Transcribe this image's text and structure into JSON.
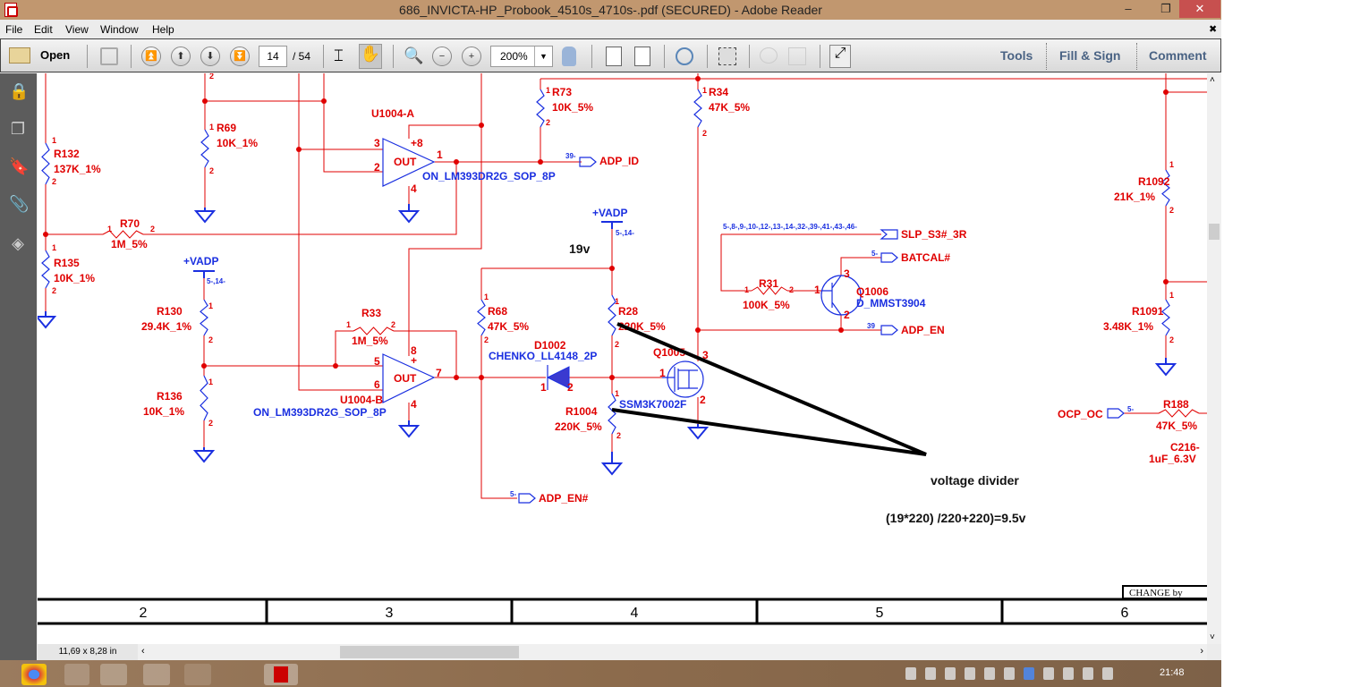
{
  "window": {
    "title": "686_INVICTA-HP_Probook_4510s_4710s-.pdf (SECURED) - Adobe Reader",
    "minimize": "‒",
    "restore": "❐",
    "close": "✕"
  },
  "menu": [
    "File",
    "Edit",
    "View",
    "Window",
    "Help"
  ],
  "menu_close": "✖",
  "toolbar": {
    "open": "Open",
    "page_current": "14",
    "page_total": "/ 54",
    "zoom": "200%",
    "tools": "Tools",
    "fill_sign": "Fill & Sign",
    "comment": "Comment"
  },
  "status": {
    "page_size": "11,69 x 8,28 in"
  },
  "clock": "21:48",
  "schematic": {
    "c": {
      "R132": [
        "R132",
        "137K_1%"
      ],
      "R135": [
        "R135",
        "10K_1%"
      ],
      "R70": [
        "R70",
        "1M_5%"
      ],
      "R69": [
        "R69",
        "10K_1%"
      ],
      "R130": [
        "R130",
        "29.4K_1%"
      ],
      "R136": [
        "R136",
        "10K_1%"
      ],
      "R33": [
        "R33",
        "1M_5%"
      ],
      "R73": [
        "R73",
        "10K_5%"
      ],
      "R34": [
        "R34",
        "47K_5%"
      ],
      "R68": [
        "R68",
        "47K_5%"
      ],
      "R28": [
        "R28",
        "220K_5%"
      ],
      "R1004": [
        "R1004",
        "220K_5%"
      ],
      "R31": [
        "R31",
        "100K_5%"
      ],
      "R1092": [
        "R1092",
        "21K_1%"
      ],
      "R1091": [
        "R1091",
        "3.48K_1%"
      ],
      "R188": [
        "R188",
        "47K_5%"
      ],
      "C216": [
        "C216-",
        "1uF_6.3V"
      ],
      "UA": [
        "U1004-A",
        "ON_LM393DR2G_SOP_8P"
      ],
      "UB": [
        "U1004-B",
        "ON_LM393DR2G_SOP_8P"
      ],
      "D1002": [
        "D1002",
        "CHENKO_LL4148_2P"
      ],
      "Q1005": [
        "Q1005",
        "SSM3K7002F"
      ],
      "Q1006": [
        "Q1006",
        "D_MMST3904"
      ]
    },
    "pins": [
      "1",
      "2",
      "3",
      "4",
      "5",
      "6",
      "7",
      "8",
      "+8",
      "+",
      "-",
      "OUT"
    ],
    "power": {
      "vadp": "+VADP",
      "vadp_refs": "5-,14-"
    },
    "nets": {
      "adp_id": [
        "39-",
        "ADP_ID"
      ],
      "slp": [
        "5-,8-,9-,10-,12-,13-,14-,32-,39-,41-,43-,46-",
        "SLP_S3#_3R"
      ],
      "batcal": [
        "5-",
        "BATCAL#"
      ],
      "adp_en": [
        "39",
        "ADP_EN"
      ],
      "adp_en_n": [
        "5-",
        "ADP_EN#"
      ],
      "ocp": [
        "5-",
        "OCP_OC"
      ]
    },
    "annotations": {
      "voltage": "19v",
      "divider": "voltage divider",
      "formula": "(19*220) /220+220)=9.5v"
    },
    "frame": {
      "columns": [
        "2",
        "3",
        "4",
        "5",
        "6"
      ],
      "change_by": "CHANGE by"
    }
  },
  "colors": {
    "wire": "#e00000",
    "symbol": "#1a2fe0",
    "titlebar": "#c1976f",
    "close": "#c7504f"
  }
}
